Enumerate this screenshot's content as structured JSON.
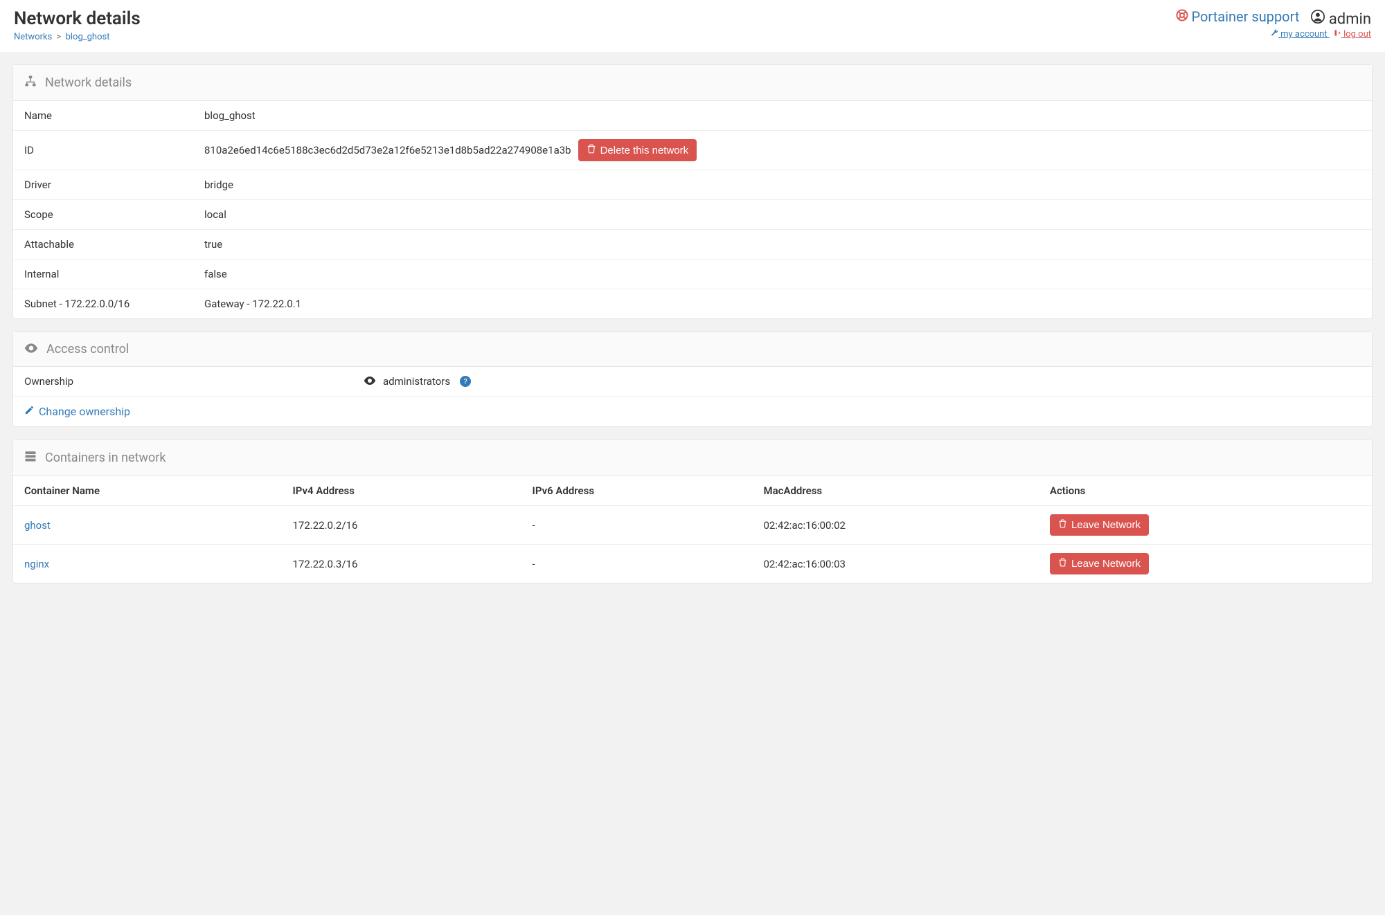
{
  "header": {
    "title": "Network details",
    "breadcrumb_root": "Networks",
    "breadcrumb_current": "blog_ghost",
    "support_label": "Portainer support",
    "user": "admin",
    "my_account": "my account",
    "log_out": "log out"
  },
  "panel_details": {
    "title": "Network details",
    "rows": {
      "name_label": "Name",
      "name_value": "blog_ghost",
      "id_label": "ID",
      "id_value": "810a2e6ed14c6e5188c3ec6d2d5d73e2a12f6e5213e1d8b5ad22a274908e1a3b",
      "delete_btn": "Delete this network",
      "driver_label": "Driver",
      "driver_value": "bridge",
      "scope_label": "Scope",
      "scope_value": "local",
      "attachable_label": "Attachable",
      "attachable_value": "true",
      "internal_label": "Internal",
      "internal_value": "false",
      "subnet_label": "Subnet - 172.22.0.0/16",
      "gateway_value": "Gateway - 172.22.0.1"
    }
  },
  "panel_access": {
    "title": "Access control",
    "ownership_label": "Ownership",
    "ownership_value": "administrators",
    "change_link": "Change ownership"
  },
  "panel_containers": {
    "title": "Containers in network",
    "columns": [
      "Container Name",
      "IPv4 Address",
      "IPv6 Address",
      "MacAddress",
      "Actions"
    ],
    "leave_btn": "Leave Network",
    "rows": [
      {
        "name": "ghost",
        "ipv4": "172.22.0.2/16",
        "ipv6": "-",
        "mac": "02:42:ac:16:00:02"
      },
      {
        "name": "nginx",
        "ipv4": "172.22.0.3/16",
        "ipv6": "-",
        "mac": "02:42:ac:16:00:03"
      }
    ]
  }
}
